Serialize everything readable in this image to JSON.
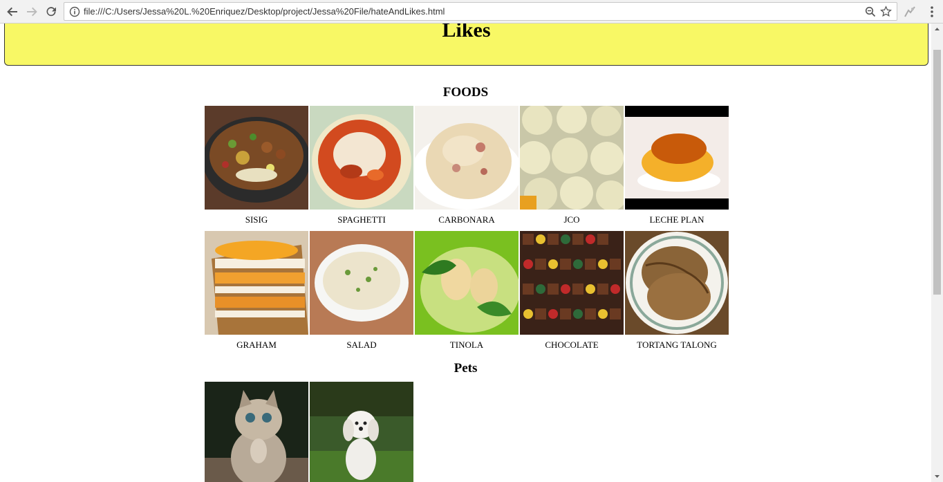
{
  "browser": {
    "url": "file:///C:/Users/Jessa%20L.%20Enriquez/Desktop/project/Jessa%20File/hateAndLikes.html",
    "icons": [
      "back-arrow-icon",
      "forward-arrow-icon",
      "reload-icon",
      "info-icon",
      "zoom-icon",
      "star-icon",
      "extension-icon",
      "menu-icon"
    ]
  },
  "page": {
    "title": "Likes",
    "header_color": "#f8f865",
    "foods": {
      "heading": "FOODS",
      "items": [
        {
          "label": "SISIG"
        },
        {
          "label": "SPAGHETTI"
        },
        {
          "label": "CARBONARA"
        },
        {
          "label": "JCO"
        },
        {
          "label": "LECHE PLAN"
        },
        {
          "label": "GRAHAM"
        },
        {
          "label": "SALAD"
        },
        {
          "label": "TINOLA"
        },
        {
          "label": "CHOCOLATE"
        },
        {
          "label": "TORTANG TALONG"
        }
      ]
    },
    "pets": {
      "heading": "Pets",
      "items": [
        {
          "image": "kitten-photo"
        },
        {
          "image": "puppy-photo"
        }
      ]
    }
  }
}
